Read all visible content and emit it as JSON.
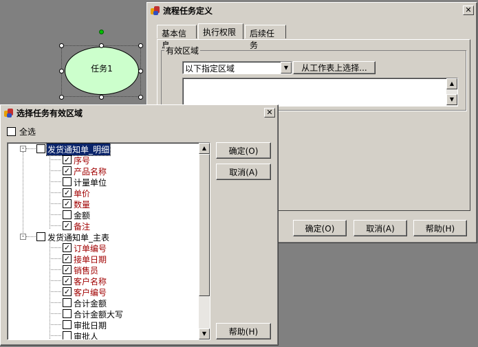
{
  "canvas": {
    "task_node_label": "任务1"
  },
  "task_def_dialog": {
    "title": "流程任务定义",
    "tabs": [
      "基本信息",
      "执行权限",
      "后续任务"
    ],
    "group_label": "有效区域",
    "scope_select_value": "以下指定区域",
    "pick_button": "从工作表上选择...",
    "ok_button": "确定(O)",
    "cancel_button": "取消(A)",
    "help_button": "帮助(H)"
  },
  "select_dialog": {
    "title": "选择任务有效区域",
    "select_all_label": "全选",
    "ok_button": "确定(O)",
    "cancel_button": "取消(A)",
    "help_button": "帮助(H)",
    "tree": [
      {
        "label": "发货通知单_明细",
        "checked": false,
        "selected": true,
        "children": [
          {
            "label": "序号",
            "checked": true
          },
          {
            "label": "产品名称",
            "checked": true
          },
          {
            "label": "计量单位",
            "checked": false
          },
          {
            "label": "单价",
            "checked": true
          },
          {
            "label": "数量",
            "checked": true
          },
          {
            "label": "金额",
            "checked": false
          },
          {
            "label": "备注",
            "checked": true
          }
        ]
      },
      {
        "label": "发货通知单_主表",
        "checked": false,
        "selected": false,
        "children": [
          {
            "label": "订单编号",
            "checked": true
          },
          {
            "label": "接单日期",
            "checked": true
          },
          {
            "label": "销售员",
            "checked": true
          },
          {
            "label": "客户名称",
            "checked": true
          },
          {
            "label": "客户编号",
            "checked": true
          },
          {
            "label": "合计金额",
            "checked": false
          },
          {
            "label": "合计金额大写",
            "checked": false
          },
          {
            "label": "审批日期",
            "checked": false
          },
          {
            "label": "审批人",
            "checked": false
          }
        ]
      }
    ]
  },
  "colors": {
    "dialog_face": "#d4d0c8",
    "workspace": "#808080",
    "node_fill": "#ccffcc",
    "checked_field_text": "#a00000",
    "selection": "#0a246a"
  },
  "icons": [
    "app-icon",
    "close-icon",
    "dropdown-arrow-icon",
    "scroll-up-icon",
    "scroll-down-icon",
    "checkmark-icon",
    "collapse-icon"
  ]
}
